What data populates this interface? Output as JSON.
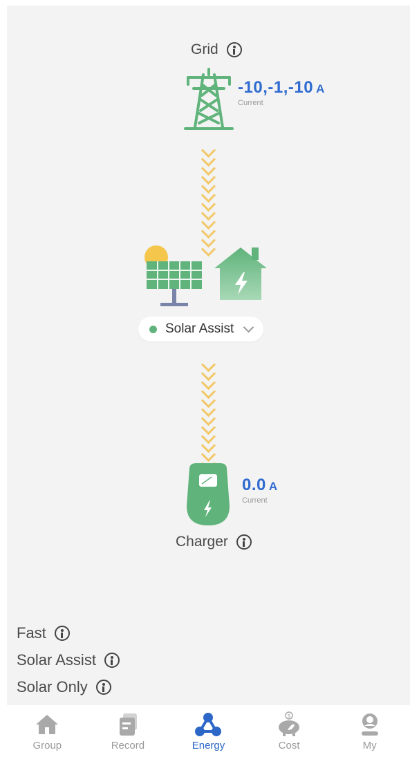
{
  "grid": {
    "label": "Grid",
    "value": "-10,-1,-10",
    "unit": "A",
    "sub": "Current"
  },
  "mode": {
    "selected": "Solar Assist",
    "dot_color": "#5fb37b"
  },
  "charger": {
    "label": "Charger",
    "value": "0.0",
    "unit": "A",
    "sub": "Current"
  },
  "modes_list": [
    "Fast",
    "Solar Assist",
    "Solar Only"
  ],
  "tabs": [
    {
      "label": "Group",
      "icon": "home-icon"
    },
    {
      "label": "Record",
      "icon": "record-icon"
    },
    {
      "label": "Energy",
      "icon": "energy-icon",
      "active": true
    },
    {
      "label": "Cost",
      "icon": "piggy-bank-icon"
    },
    {
      "label": "My",
      "icon": "user-icon"
    }
  ],
  "colors": {
    "accent": "#2c67c7",
    "green": "#5fb37b",
    "flow": "#f2c45a"
  }
}
